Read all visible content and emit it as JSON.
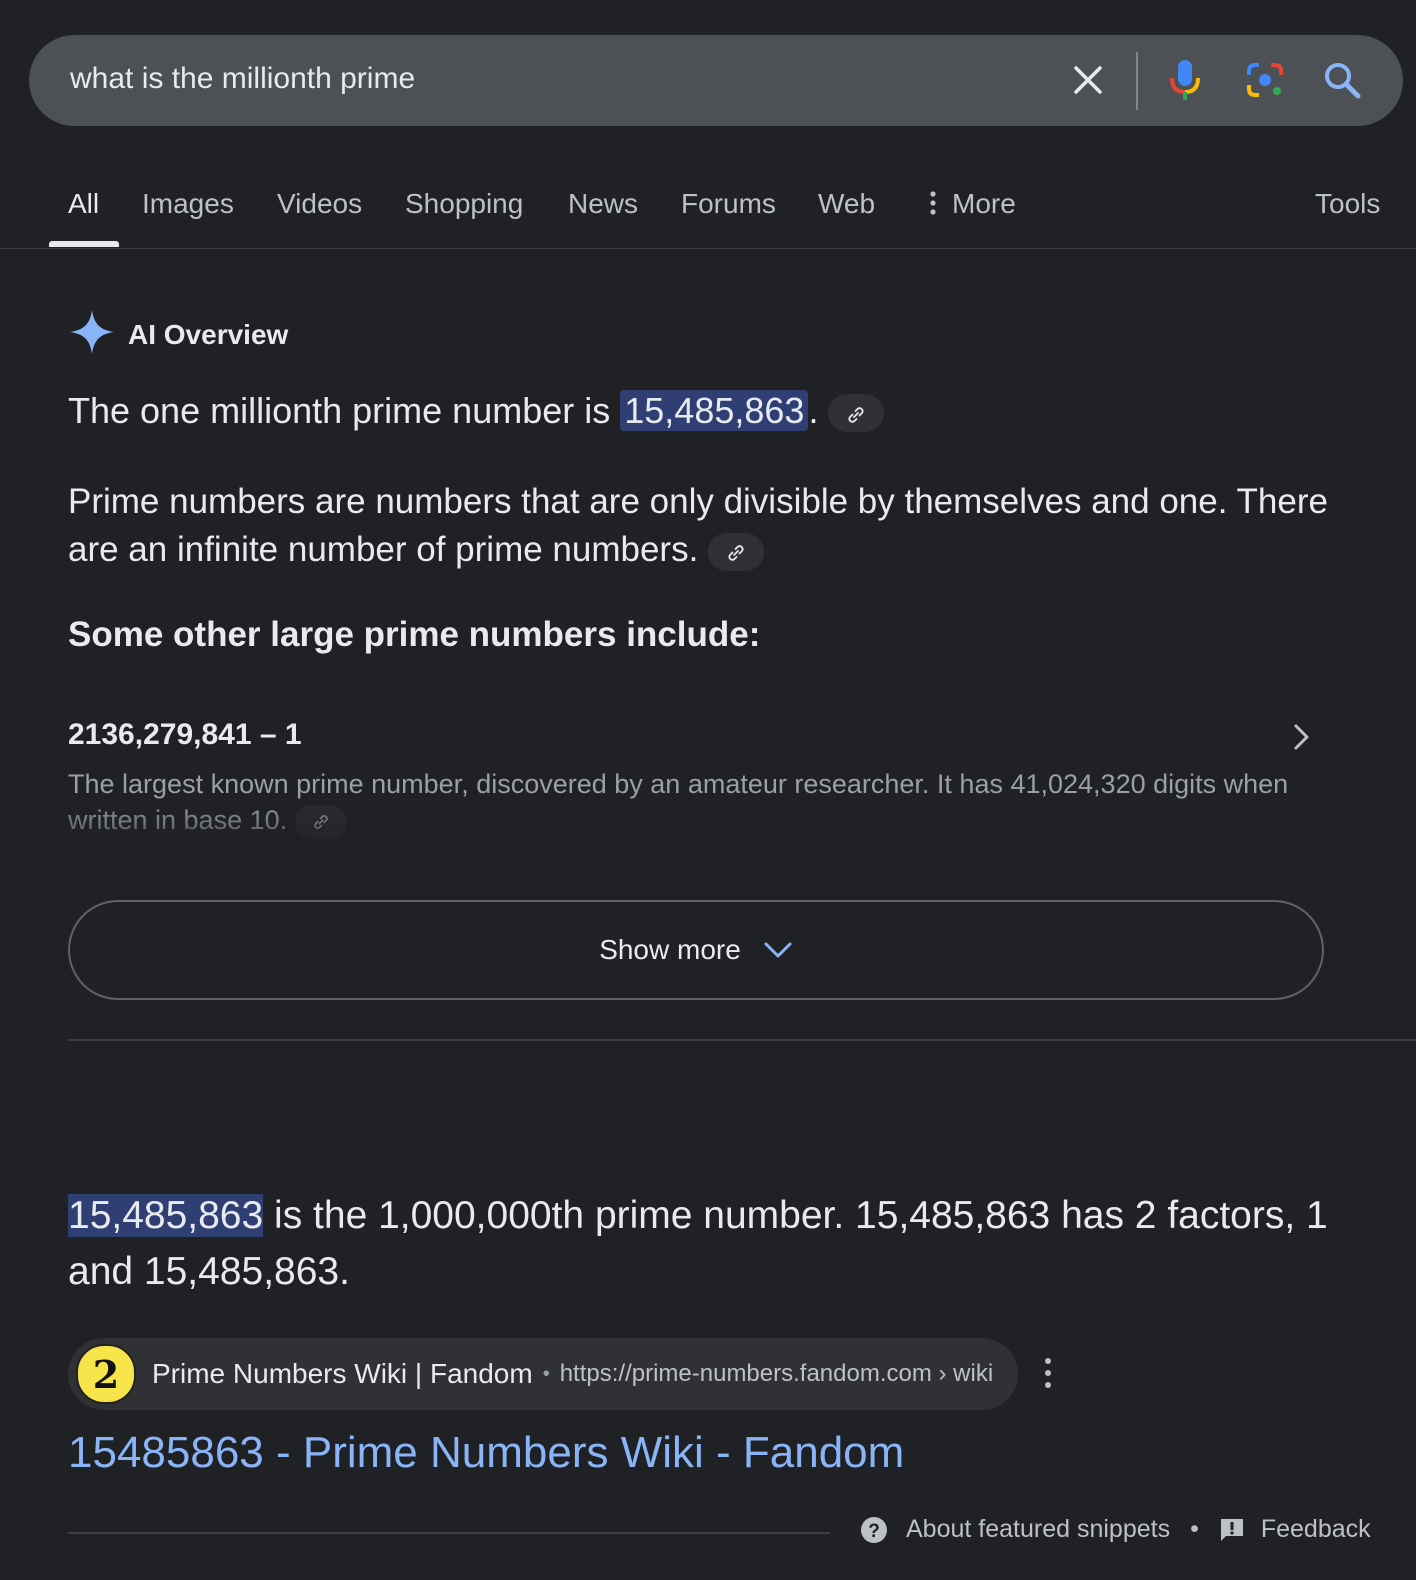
{
  "search": {
    "query": "what is the millionth prime"
  },
  "tabs": [
    {
      "label": "All"
    },
    {
      "label": "Images"
    },
    {
      "label": "Videos"
    },
    {
      "label": "Shopping"
    },
    {
      "label": "News"
    },
    {
      "label": "Forums"
    },
    {
      "label": "Web"
    },
    {
      "label": "More"
    },
    {
      "label": "Tools"
    }
  ],
  "ai_overview": {
    "title": "AI Overview",
    "answer_prefix": "The one millionth prime number is",
    "answer_value": "15,485,863",
    "answer_suffix": ".",
    "paragraph": "Prime numbers are numbers that are only divisible by themselves and one. There are an infinite number of prime numbers.",
    "subheading": "Some other large prime numbers include:",
    "item_title": "2136,279,841 – 1",
    "item_desc": "The largest known prime number, discovered by an amateur researcher. It has 41,024,320 digits when written in base 10.",
    "show_more": "Show more"
  },
  "snippet": {
    "highlight": "15,485,863",
    "text": " is the 1,000,000th prime number. 15,485,863 has 2 factors, 1 and 15,485,863."
  },
  "source": {
    "favicon_text": "2",
    "name": "Prime Numbers Wiki | Fandom",
    "url": "https://prime-numbers.fandom.com › wiki"
  },
  "result": {
    "title": "15485863 - Prime Numbers Wiki - Fandom"
  },
  "footer": {
    "about": "About featured snippets",
    "separator": "•",
    "feedback": "Feedback"
  },
  "colors": {
    "background": "#202124",
    "link": "#8ab4f8",
    "highlight": "#2f3f74",
    "sparkle": "#8ab4f8"
  }
}
